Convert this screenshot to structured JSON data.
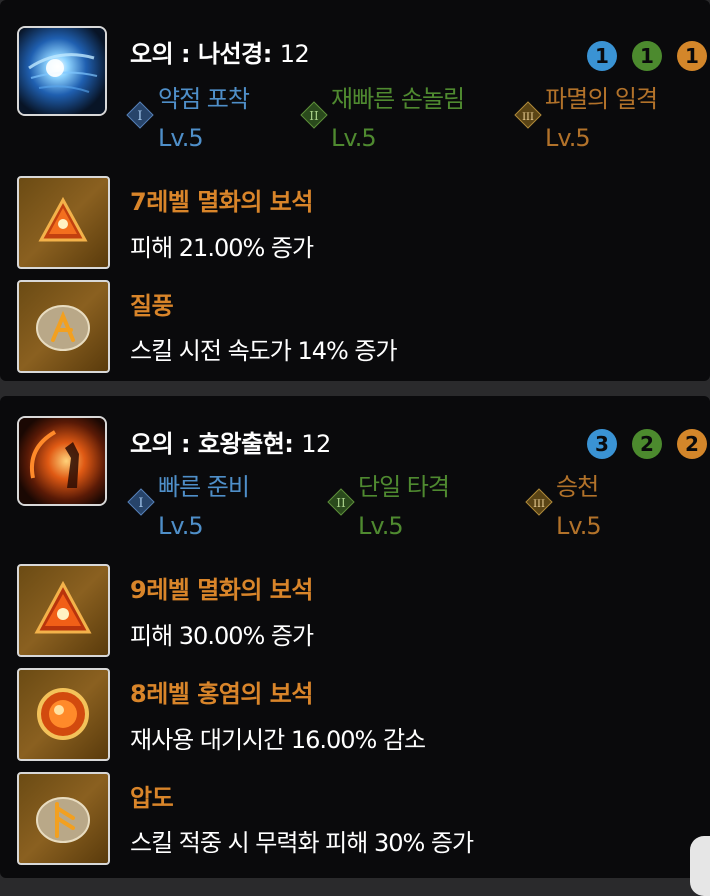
{
  "colors": {
    "tier1": "#3a93d4",
    "tier2": "#4c8a2e",
    "tier3": "#d3862a",
    "tier1_text": "#4f8fc9",
    "tier2_text": "#4f8a30",
    "tier3_text": "#b2722a",
    "gem_title": "#d9852a"
  },
  "skills": [
    {
      "name": "오의 : 나선경",
      "level_sep": ":",
      "level": "12",
      "badges": [
        "1",
        "1",
        "1"
      ],
      "tripods": [
        {
          "tier": "I",
          "name": "약점 포착",
          "level": "Lv.5"
        },
        {
          "tier": "II",
          "name": "재빠른 손놀림",
          "level": "Lv.5"
        },
        {
          "tier": "III",
          "name": "파멸의 일격",
          "level": "Lv.5"
        }
      ],
      "gems": [
        {
          "icon": "triangle-gem-icon",
          "title": "7레벨 멸화의 보석",
          "desc": "피해 21.00% 증가"
        },
        {
          "icon": "rune-stone-icon",
          "title": "질풍",
          "desc": "스킬 시전 속도가 14% 증가"
        }
      ]
    },
    {
      "name": "오의 : 호왕출현",
      "level_sep": ":",
      "level": "12",
      "badges": [
        "3",
        "2",
        "2"
      ],
      "tripods": [
        {
          "tier": "I",
          "name": "빠른 준비",
          "level": "Lv.5"
        },
        {
          "tier": "II",
          "name": "단일 타격",
          "level": "Lv.5"
        },
        {
          "tier": "III",
          "name": "승천",
          "level": "Lv.5"
        }
      ],
      "gems": [
        {
          "icon": "triangle-gem-icon",
          "title": "9레벨 멸화의 보석",
          "desc": "피해 30.00% 증가"
        },
        {
          "icon": "round-gem-icon",
          "title": "8레벨 홍염의 보석",
          "desc": "재사용 대기시간 16.00% 감소"
        },
        {
          "icon": "rune-stone-icon",
          "title": "압도",
          "desc": "스킬 적중 시 무력화 피해 30% 증가"
        }
      ]
    }
  ]
}
